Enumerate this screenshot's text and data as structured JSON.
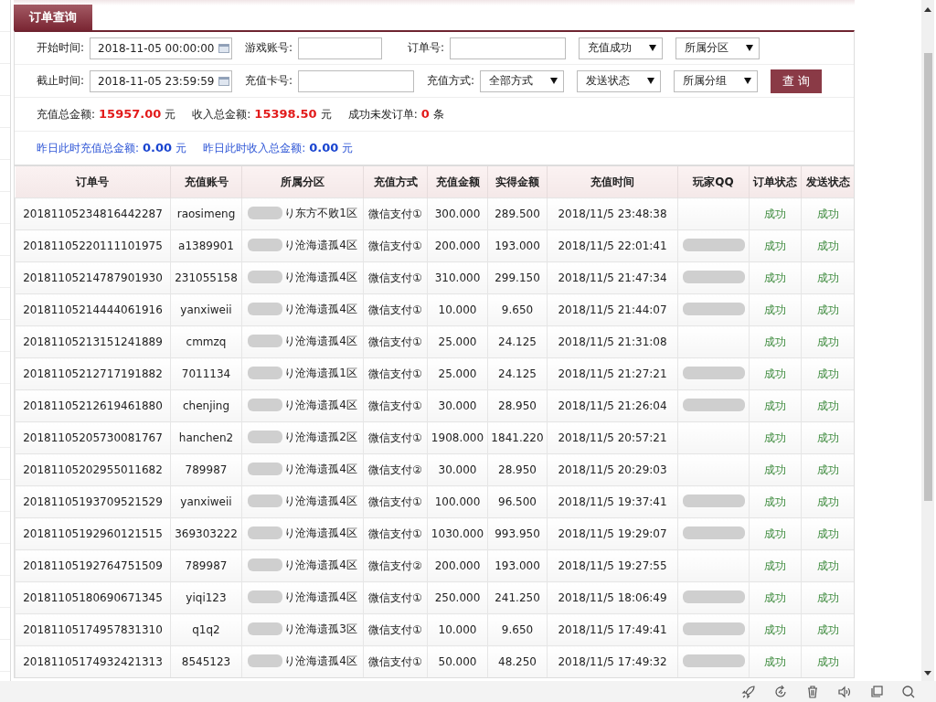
{
  "tab": {
    "label": "订单查询",
    "selected": true
  },
  "filter_rows": [
    [
      {
        "kind": "date",
        "label": "开始时间:",
        "value": "2018-11-05 00:00:00"
      },
      {
        "kind": "text",
        "label": "游戏账号:"
      },
      {
        "kind": "text",
        "label": "订单号:"
      },
      {
        "kind": "select",
        "value": "充值成功"
      },
      {
        "kind": "select",
        "value": "所属分区"
      }
    ],
    [
      {
        "kind": "date",
        "label": "截止时间:",
        "value": "2018-11-05 23:59:59"
      },
      {
        "kind": "text",
        "label": "充值卡号:"
      },
      {
        "kind": "select",
        "label": "充值方式:",
        "value": "全部方式"
      },
      {
        "kind": "select",
        "value": "发送状态"
      },
      {
        "kind": "select",
        "value": "所属分组"
      },
      {
        "kind": "button",
        "value": "查 询"
      }
    ]
  ],
  "totals": [
    {
      "label": "充值总金额:",
      "value": "15957.00",
      "unit": "元"
    },
    {
      "label": "收入总金额:",
      "value": "15398.50",
      "unit": "元"
    },
    {
      "label": "成功未发订单:",
      "value": "0",
      "unit": "条"
    }
  ],
  "yesterday": [
    {
      "label": "昨日此时充值总金额:",
      "value": "0.00",
      "unit": "元"
    },
    {
      "label": "昨日此时收入总金额:",
      "value": "0.00",
      "unit": "元"
    }
  ],
  "table": {
    "columns": [
      "订单号",
      "充值账号",
      "所属分区",
      "充值方式",
      "充值金额",
      "实得金额",
      "充值时间",
      "玩家QQ",
      "订单状态",
      "发送状态"
    ],
    "rows": [
      {
        "order": "20181105234816442287",
        "account": "raosimeng",
        "zone": "り东方不败1区",
        "method": "微信支付①",
        "amount": "300.000",
        "received": "289.500",
        "time": "2018/11/5 23:48:38",
        "qq_blurred": false,
        "order_status": "成功",
        "send_status": "成功"
      },
      {
        "order": "20181105220111101975",
        "account": "a1389901",
        "zone": "り沧海遗孤4区",
        "method": "微信支付①",
        "amount": "200.000",
        "received": "193.000",
        "time": "2018/11/5 22:01:41",
        "qq_blurred": true,
        "order_status": "成功",
        "send_status": "成功"
      },
      {
        "order": "20181105214787901930",
        "account": "231055158",
        "zone": "り沧海遗孤4区",
        "method": "微信支付①",
        "amount": "310.000",
        "received": "299.150",
        "time": "2018/11/5 21:47:34",
        "qq_blurred": true,
        "order_status": "成功",
        "send_status": "成功"
      },
      {
        "order": "20181105214444061916",
        "account": "yanxiweii",
        "zone": "り沧海遗孤4区",
        "method": "微信支付①",
        "amount": "10.000",
        "received": "9.650",
        "time": "2018/11/5 21:44:07",
        "qq_blurred": true,
        "order_status": "成功",
        "send_status": "成功"
      },
      {
        "order": "20181105213151241889",
        "account": "cmmzq",
        "zone": "り沧海遗孤4区",
        "method": "微信支付①",
        "amount": "25.000",
        "received": "24.125",
        "time": "2018/11/5 21:31:08",
        "qq_blurred": false,
        "order_status": "成功",
        "send_status": "成功"
      },
      {
        "order": "20181105212717191882",
        "account": "7011134",
        "zone": "り沧海遗孤1区",
        "method": "微信支付①",
        "amount": "25.000",
        "received": "24.125",
        "time": "2018/11/5 21:27:21",
        "qq_blurred": true,
        "order_status": "成功",
        "send_status": "成功"
      },
      {
        "order": "20181105212619461880",
        "account": "chenjing",
        "zone": "り沧海遗孤4区",
        "method": "微信支付①",
        "amount": "30.000",
        "received": "28.950",
        "time": "2018/11/5 21:26:04",
        "qq_blurred": true,
        "order_status": "成功",
        "send_status": "成功"
      },
      {
        "order": "20181105205730081767",
        "account": "hanchen2",
        "zone": "り沧海遗孤2区",
        "method": "微信支付①",
        "amount": "1908.000",
        "received": "1841.220",
        "time": "2018/11/5 20:57:21",
        "qq_blurred": false,
        "order_status": "成功",
        "send_status": "成功"
      },
      {
        "order": "20181105202955011682",
        "account": "789987",
        "zone": "り沧海遗孤4区",
        "method": "微信支付②",
        "amount": "30.000",
        "received": "28.950",
        "time": "2018/11/5 20:29:03",
        "qq_blurred": false,
        "order_status": "成功",
        "send_status": "成功"
      },
      {
        "order": "20181105193709521529",
        "account": "yanxiweii",
        "zone": "り沧海遗孤4区",
        "method": "微信支付①",
        "amount": "100.000",
        "received": "96.500",
        "time": "2018/11/5 19:37:41",
        "qq_blurred": true,
        "order_status": "成功",
        "send_status": "成功"
      },
      {
        "order": "20181105192960121515",
        "account": "369303222",
        "zone": "り沧海遗孤4区",
        "method": "微信支付①",
        "amount": "1030.000",
        "received": "993.950",
        "time": "2018/11/5 19:29:07",
        "qq_blurred": true,
        "order_status": "成功",
        "send_status": "成功"
      },
      {
        "order": "20181105192764751509",
        "account": "789987",
        "zone": "り沧海遗孤4区",
        "method": "微信支付②",
        "amount": "200.000",
        "received": "193.000",
        "time": "2018/11/5 19:27:55",
        "qq_blurred": false,
        "order_status": "成功",
        "send_status": "成功"
      },
      {
        "order": "20181105180690671345",
        "account": "yiqi123",
        "zone": "り沧海遗孤4区",
        "method": "微信支付①",
        "amount": "250.000",
        "received": "241.250",
        "time": "2018/11/5 18:06:49",
        "qq_blurred": true,
        "order_status": "成功",
        "send_status": "成功"
      },
      {
        "order": "20181105174957831310",
        "account": "q1q2",
        "zone": "り沧海遗孤3区",
        "method": "微信支付①",
        "amount": "10.000",
        "received": "9.650",
        "time": "2018/11/5 17:49:41",
        "qq_blurred": true,
        "order_status": "成功",
        "send_status": "成功"
      },
      {
        "order": "20181105174932421313",
        "account": "8545123",
        "zone": "り沧海遗孤4区",
        "method": "微信支付①",
        "amount": "50.000",
        "received": "48.250",
        "time": "2018/11/5 17:49:32",
        "qq_blurred": true,
        "order_status": "成功",
        "send_status": "成功"
      }
    ]
  }
}
